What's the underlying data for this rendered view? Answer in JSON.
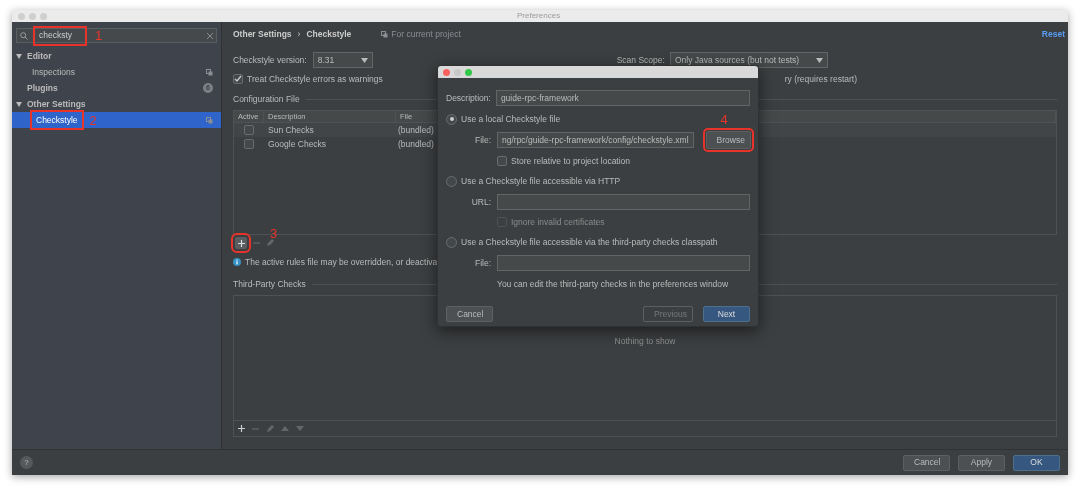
{
  "window": {
    "title": "Preferences"
  },
  "search": {
    "value": "checksty",
    "annotation": "1"
  },
  "sidebar": {
    "items": [
      {
        "label": "Editor",
        "expanded": true,
        "selected": false,
        "children": [
          {
            "label": "Inspections",
            "selected": false
          }
        ]
      },
      {
        "label": "Plugins",
        "badge": "6",
        "selected": false
      },
      {
        "label": "Other Settings",
        "expanded": true,
        "selected": false,
        "children": [
          {
            "label": "Checkstyle",
            "selected": true,
            "annotation": "2"
          }
        ]
      }
    ]
  },
  "breadcrumb": {
    "items": [
      "Other Settings",
      "Checkstyle"
    ],
    "separator": "›"
  },
  "scope_note": "For current project",
  "reset": "Reset",
  "version": {
    "label": "Checkstyle version:",
    "value": "8.31"
  },
  "scan_scope": {
    "label": "Scan Scope:",
    "value": "Only Java sources (but not tests)"
  },
  "treat_warnings": {
    "label": "Treat Checkstyle errors as warnings",
    "checked": true
  },
  "partial_option": "ry (requires restart)",
  "config_section": {
    "title": "Configuration File",
    "columns": [
      "Active",
      "Description",
      "File"
    ],
    "rows": [
      {
        "active": false,
        "description": "Sun Checks",
        "file": "(bundled)"
      },
      {
        "active": false,
        "description": "Google Checks",
        "file": "(bundled)"
      }
    ],
    "toolbar_annotation": "3",
    "info": "The active rules file may be overridden, or deactiva"
  },
  "third_party": {
    "title": "Third-Party Checks",
    "empty": "Nothing to show"
  },
  "dialog": {
    "description": {
      "label": "Description:",
      "value": "guide-rpc-framework"
    },
    "options": [
      {
        "kind": "local",
        "label": "Use a local Checkstyle file",
        "selected": true,
        "file_label": "File:",
        "file_value": "ng/rpc/guide-rpc-framework/config/checkstyle.xml",
        "browse": "Browse",
        "browse_annotation": "4",
        "store_relative": {
          "label": "Store relative to project location",
          "checked": false
        }
      },
      {
        "kind": "http",
        "label": "Use a Checkstyle file accessible via HTTP",
        "selected": false,
        "url_label": "URL:",
        "ignore": {
          "label": "Ignore invalid certificates",
          "checked": false,
          "disabled": true
        }
      },
      {
        "kind": "classpath",
        "label": "Use a Checkstyle file accessible via the third-party checks classpath",
        "selected": false,
        "file_label": "File:",
        "note": "You can edit the third-party checks in the preferences window"
      }
    ],
    "cancel": "Cancel",
    "previous": {
      "label": "Previous",
      "disabled": true
    },
    "next": "Next"
  },
  "footer": {
    "help": "?",
    "buttons": [
      {
        "label": "Cancel",
        "primary": false
      },
      {
        "label": "Apply",
        "primary": false
      },
      {
        "label": "OK",
        "primary": true
      }
    ]
  }
}
